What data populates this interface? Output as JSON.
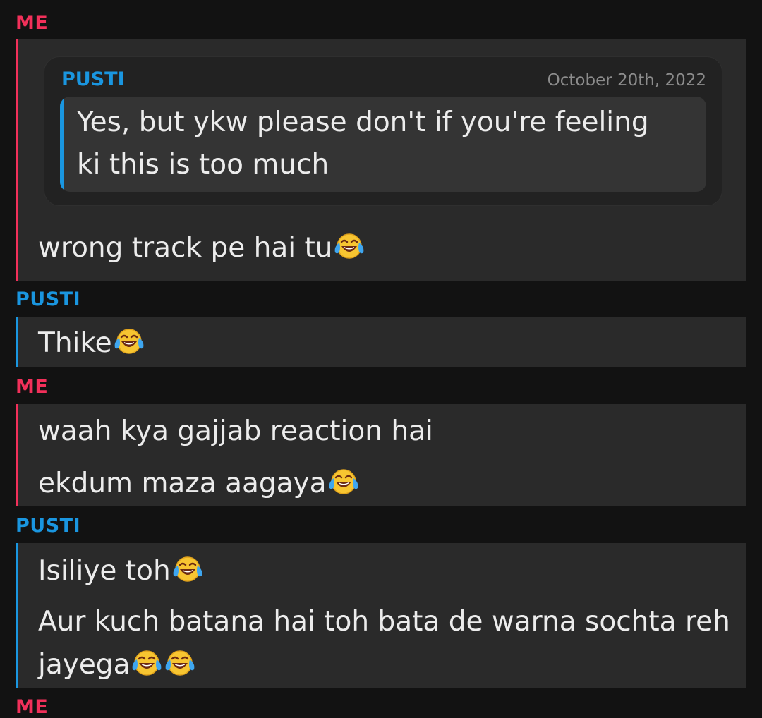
{
  "messages": [
    {
      "sender": "ME",
      "quote": {
        "sender": "PUSTI",
        "date": "October 20th, 2022",
        "lines": [
          "Yes, but ykw please don't if you're feeling",
          "ki this is too much"
        ]
      },
      "lines": [
        "wrong track pe hai tu"
      ]
    },
    {
      "sender": "PUSTI",
      "lines": [
        "Thike"
      ]
    },
    {
      "sender": "ME",
      "lines": [
        "waah kya gajjab reaction hai",
        "ekdum maza aagaya"
      ]
    },
    {
      "sender": "PUSTI",
      "lines": [
        "Isiliye toh",
        "Aur kuch batana hai toh bata de warna sochta reh",
        "jayega"
      ]
    },
    {
      "sender": "ME",
      "lines": []
    }
  ],
  "emoji": {
    "name": "face-with-tears-of-joy-icon",
    "colors": {
      "face": "#f7c531",
      "outline": "#e0a21c",
      "tears": "#3ea6f0",
      "mouth": "#6b2a12"
    }
  },
  "colors": {
    "background": "#121212",
    "bubble": "#2a2a2a",
    "me_accent": "#f2305a",
    "pusti_accent": "#1a96e0",
    "text": "#ececec",
    "date": "#8c8c8c"
  }
}
